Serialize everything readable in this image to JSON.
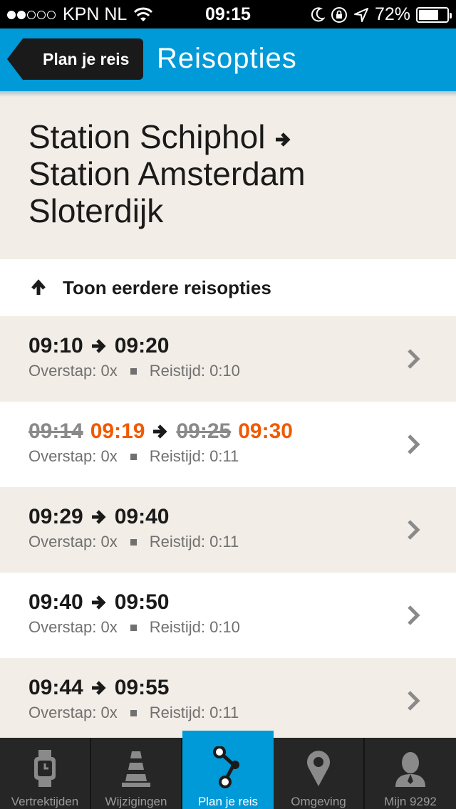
{
  "status_bar": {
    "carrier": "KPN NL",
    "time": "09:15",
    "battery": "72%",
    "battery_level": 0.72,
    "signal_bars_filled": 2,
    "signal_bars_total": 5
  },
  "nav": {
    "back_label": "Plan je reis",
    "title": "Reisopties"
  },
  "route": {
    "from": "Station Schiphol",
    "to": "Station Amsterdam Sloterdijk"
  },
  "earlier_label": "Toon eerdere reisopties",
  "trips": [
    {
      "depart": "09:10",
      "arrive": "09:20",
      "transfer": "Overstap: 0x",
      "duration": "Reistijd: 0:10"
    },
    {
      "depart_planned": "09:14",
      "depart": "09:19",
      "arrive_planned": "09:25",
      "arrive": "09:30",
      "transfer": "Overstap: 0x",
      "duration": "Reistijd: 0:11",
      "delayed": true
    },
    {
      "depart": "09:29",
      "arrive": "09:40",
      "transfer": "Overstap: 0x",
      "duration": "Reistijd: 0:11"
    },
    {
      "depart": "09:40",
      "arrive": "09:50",
      "transfer": "Overstap: 0x",
      "duration": "Reistijd: 0:10"
    },
    {
      "depart": "09:44",
      "arrive": "09:55",
      "transfer": "Overstap: 0x",
      "duration": "Reistijd: 0:11"
    }
  ],
  "tabs": [
    {
      "label": "Vertrektijden",
      "icon": "watch-icon"
    },
    {
      "label": "Wijzigingen",
      "icon": "traffic-cone-icon"
    },
    {
      "label": "Plan je reis",
      "icon": "route-icon",
      "active": true
    },
    {
      "label": "Omgeving",
      "icon": "location-pin-icon"
    },
    {
      "label": "Mijn 9292",
      "icon": "user-icon"
    }
  ],
  "colors": {
    "primary": "#009ad8",
    "delay": "#f05a00",
    "background": "#f2ede6"
  }
}
